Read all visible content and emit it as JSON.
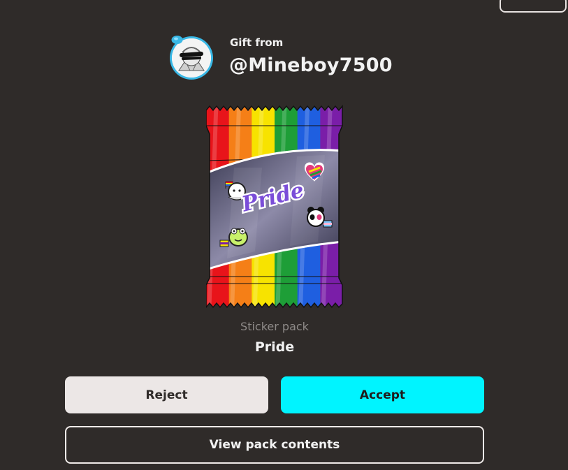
{
  "gift": {
    "label": "Gift from",
    "sender": "@Mineboy7500"
  },
  "pack": {
    "type": "Sticker pack",
    "name": "Pride",
    "wrapper_text": "Pride",
    "stripe_colors": [
      "#e8141a",
      "#f57f17",
      "#f7e300",
      "#1e9e37",
      "#1f5fe0",
      "#7a1ea8"
    ]
  },
  "actions": {
    "reject": "Reject",
    "accept": "Accept",
    "view_contents": "View pack contents"
  },
  "colors": {
    "background": "#2f2b29",
    "accept": "#00f4ff",
    "reject": "#ece7e6",
    "avatar_ring": "#39b8e6"
  }
}
